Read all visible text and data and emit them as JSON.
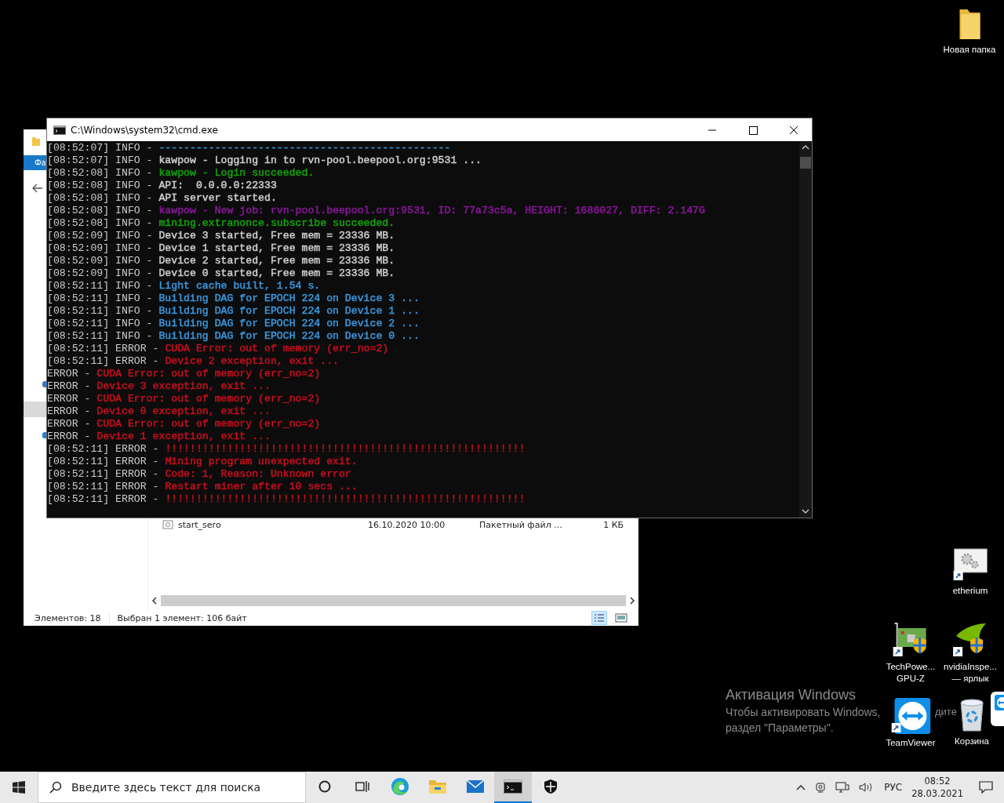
{
  "desktop_icons": [
    {
      "kind": "folder",
      "lines": [
        "Новая папка"
      ]
    },
    {
      "kind": "settings-shortcut",
      "lines": [
        "etherium"
      ]
    },
    {
      "kind": "gpu-card",
      "lines": [
        "TechPowe...",
        "GPU-Z"
      ]
    },
    {
      "kind": "nvidia",
      "lines": [
        "nvidiaInspe...",
        "— ярлык"
      ]
    },
    {
      "kind": "teamviewer",
      "lines": [
        "TeamViewer"
      ]
    },
    {
      "kind": "recycle-bin",
      "lines": [
        "Корзина"
      ]
    }
  ],
  "activation": {
    "title": "Активация Windows",
    "line_1": "Чтобы активировать Windows,",
    "line_1_tail": "дите",
    "line_2": "раздел \"Параметры\"."
  },
  "explorer": {
    "ribbon_tab": "Фа",
    "file_row": {
      "name": "start_sero",
      "date": "16.10.2020 10:00",
      "type": "Пакетный файл ...",
      "size": "1 КБ"
    },
    "status_count": "Элементов: 18",
    "status_selected": "Выбран 1 элемент: 106 байт"
  },
  "console": {
    "title": "C:\\Windows\\system32\\cmd.exe",
    "lines": [
      {
        "prefix": "[08:52:07] INFO - ",
        "message": "-----------------------------------------------",
        "color": "#3a96dd"
      },
      {
        "prefix": "[08:52:07] INFO - ",
        "message": "kawpow - Logging in to rvn-pool.beepool.org:9531 ...",
        "color": "#cccccc"
      },
      {
        "prefix": "[08:52:08] INFO - ",
        "message": "kawpow - Login succeeded.",
        "color": "#13a10e"
      },
      {
        "prefix": "[08:52:08] INFO - ",
        "message": "API:  0.0.0.0:22333",
        "color": "#cccccc"
      },
      {
        "prefix": "[08:52:08] INFO - ",
        "message": "API server started.",
        "color": "#cccccc"
      },
      {
        "prefix": "[08:52:08] INFO - ",
        "message": "kawpow - New job: rvn-pool.beepool.org:9531, ID: 77a73c5a, HEIGHT: 1686027, DIFF: 2.147G",
        "color": "#881798"
      },
      {
        "prefix": "[08:52:08] INFO - ",
        "message": "mining.extranonce.subscribe succeeded.",
        "color": "#13a10e"
      },
      {
        "prefix": "[08:52:09] INFO - ",
        "message": "Device 3 started, Free mem = 23336 MB.",
        "color": "#cccccc"
      },
      {
        "prefix": "[08:52:09] INFO - ",
        "message": "Device 1 started, Free mem = 23336 MB.",
        "color": "#cccccc"
      },
      {
        "prefix": "[08:52:09] INFO - ",
        "message": "Device 2 started, Free mem = 23336 MB.",
        "color": "#cccccc"
      },
      {
        "prefix": "[08:52:09] INFO - ",
        "message": "Device 0 started, Free mem = 23336 MB.",
        "color": "#cccccc"
      },
      {
        "prefix": "[08:52:11] INFO - ",
        "message": "Light cache built, 1.54 s.",
        "color": "#3a96dd"
      },
      {
        "prefix": "[08:52:11] INFO - ",
        "message": "Building DAG for EPOCH 224 on Device 3 ...",
        "color": "#3a96dd"
      },
      {
        "prefix": "[08:52:11] INFO - ",
        "message": "Building DAG for EPOCH 224 on Device 1 ...",
        "color": "#3a96dd"
      },
      {
        "prefix": "[08:52:11] INFO - ",
        "message": "Building DAG for EPOCH 224 on Device 2 ...",
        "color": "#3a96dd"
      },
      {
        "prefix": "[08:52:11] INFO - ",
        "message": "Building DAG for EPOCH 224 on Device 0 ...",
        "color": "#3a96dd"
      },
      {
        "prefix": "[08:52:11] ERROR - ",
        "message": "CUDA Error: out of memory (err_no=2)",
        "color": "#c50f1f"
      },
      {
        "prefix": "[08:52:11] ERROR - ",
        "message": "Device 2 exception, exit ...",
        "color": "#c50f1f"
      },
      {
        "prefix": "ERROR - ",
        "message": "CUDA Error: out of memory (err_no=2)",
        "color": "#c50f1f"
      },
      {
        "prefix": "ERROR - ",
        "message": "Device 3 exception, exit ...",
        "color": "#c50f1f"
      },
      {
        "prefix": "ERROR - ",
        "message": "CUDA Error: out of memory (err_no=2)",
        "color": "#c50f1f"
      },
      {
        "prefix": "ERROR - ",
        "message": "Device 0 exception, exit ...",
        "color": "#c50f1f"
      },
      {
        "prefix": "ERROR - ",
        "message": "CUDA Error: out of memory (err_no=2)",
        "color": "#c50f1f"
      },
      {
        "prefix": "ERROR - ",
        "message": "Device 1 exception, exit ...",
        "color": "#c50f1f"
      },
      {
        "prefix": "[08:52:11] ERROR - ",
        "message": "!!!!!!!!!!!!!!!!!!!!!!!!!!!!!!!!!!!!!!!!!!!!!!!!!!!!!!!!!!",
        "color": "#c50f1f"
      },
      {
        "prefix": "[08:52:11] ERROR - ",
        "message": "Mining program unexpected exit.",
        "color": "#c50f1f"
      },
      {
        "prefix": "[08:52:11] ERROR - ",
        "message": "Code: 1, Reason: Unknown error",
        "color": "#c50f1f"
      },
      {
        "prefix": "[08:52:11] ERROR - ",
        "message": "Restart miner after 10 secs ...",
        "color": "#c50f1f"
      },
      {
        "prefix": "[08:52:11] ERROR - ",
        "message": "!!!!!!!!!!!!!!!!!!!!!!!!!!!!!!!!!!!!!!!!!!!!!!!!!!!!!!!!!!",
        "color": "#c50f1f"
      }
    ]
  },
  "taskbar": {
    "search_placeholder": "Введите здесь текст для поиска",
    "apps": [
      {
        "kind": "cortana",
        "selected": false
      },
      {
        "kind": "task-view",
        "selected": false
      },
      {
        "kind": "edge",
        "selected": false
      },
      {
        "kind": "explorer",
        "selected": false
      },
      {
        "kind": "mail",
        "selected": false
      },
      {
        "kind": "cmd",
        "selected": true
      },
      {
        "kind": "security",
        "selected": false
      }
    ],
    "language": "РУС",
    "time": "08:52",
    "date": "28.03.2021"
  }
}
